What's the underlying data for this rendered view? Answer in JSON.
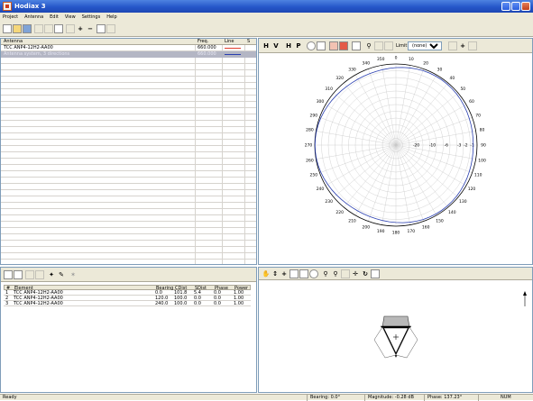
{
  "window": {
    "title": "Hodiax 3"
  },
  "menu": [
    "Project",
    "Antenna",
    "Edit",
    "View",
    "Settings",
    "Help"
  ],
  "antenna_table": {
    "headers": [
      "Antenna",
      "Freq.",
      "Line",
      "S"
    ],
    "rows": [
      {
        "name": "TCC ANP4-12H2-AA00",
        "freq": "660.000"
      },
      {
        "name": "Antenna system, 3 directions",
        "freq": "660.000"
      }
    ]
  },
  "radiation_toolbar": {
    "limit_label": "Limit",
    "limit_value": "(none)"
  },
  "polar_plot": {
    "angle_labels": [
      "0",
      "10",
      "20",
      "30",
      "40",
      "50",
      "60",
      "70",
      "80",
      "90",
      "100",
      "110",
      "120",
      "130",
      "140",
      "150",
      "160",
      "170",
      "180",
      "190",
      "200",
      "210",
      "220",
      "230",
      "240",
      "250",
      "260",
      "270",
      "280",
      "290",
      "300",
      "310",
      "320",
      "330",
      "340",
      "350"
    ],
    "radial_labels": [
      "-20",
      "-10",
      "-6",
      "-3",
      "-2",
      "-1"
    ]
  },
  "element_table": {
    "headers": [
      "#",
      "Element",
      "Bearing",
      "CDist",
      "SDist",
      "Phase",
      "Power"
    ],
    "rows": [
      [
        "1",
        "TCC ANP4-12H2-AA00",
        "0.0",
        "101.8",
        "5.4",
        "0.0",
        "1.00"
      ],
      [
        "2",
        "TCC ANP4-12H2-AA00",
        "120.0",
        "100.0",
        "0.0",
        "0.0",
        "1.00"
      ],
      [
        "3",
        "TCC ANP4-12H2-AA00",
        "240.0",
        "100.0",
        "0.0",
        "0.0",
        "1.00"
      ]
    ]
  },
  "statusbar": {
    "ready": "Ready",
    "bearing": "Bearing: 0.0°",
    "magnitude": "Magnitude: -0.28 dB",
    "phase": "Phase: 137.23°",
    "num": "NUM"
  }
}
